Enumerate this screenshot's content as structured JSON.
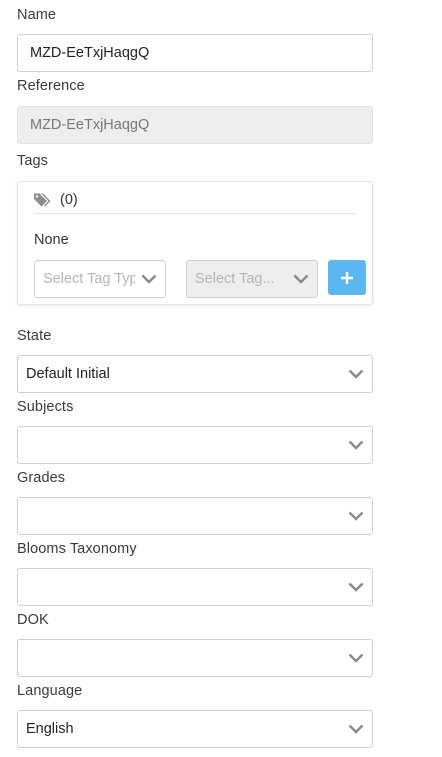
{
  "name": {
    "label": "Name",
    "value": "MZD-EeTxjHaqgQ"
  },
  "reference": {
    "label": "Reference",
    "value": "MZD-EeTxjHaqgQ"
  },
  "tags": {
    "label": "Tags",
    "count": "(0)",
    "empty_text": "None",
    "type_placeholder": "Select Tag Type",
    "tag_placeholder": "Select Tag...",
    "add_icon": "plus-icon",
    "tag_icon": "tags-icon",
    "accent_color": "#5bb7ef"
  },
  "state": {
    "label": "State",
    "value": "Default Initial"
  },
  "subjects": {
    "label": "Subjects",
    "value": ""
  },
  "grades": {
    "label": "Grades",
    "value": ""
  },
  "blooms": {
    "label": "Blooms Taxonomy",
    "value": ""
  },
  "dok": {
    "label": "DOK",
    "value": ""
  },
  "language": {
    "label": "Language",
    "value": "English"
  }
}
